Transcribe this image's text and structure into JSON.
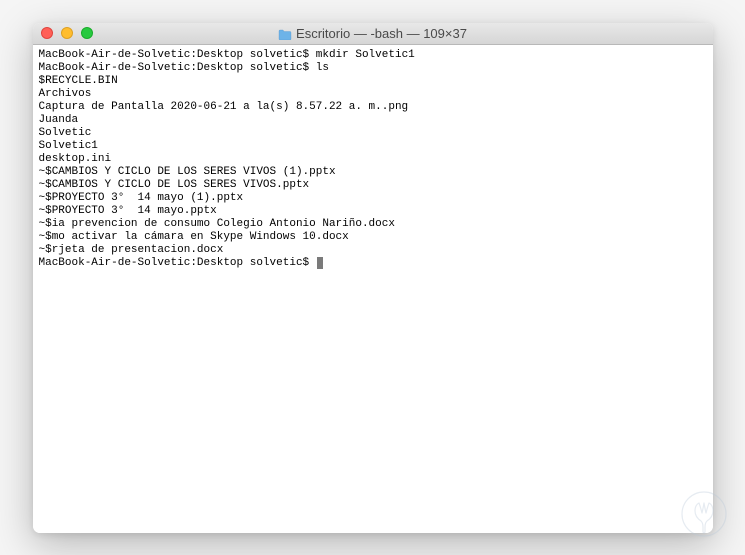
{
  "window": {
    "title": "Escritorio — -bash — 109×37"
  },
  "terminal": {
    "lines": [
      {
        "prompt": "MacBook-Air-de-Solvetic:Desktop solvetic$ ",
        "command": "mkdir Solvetic1"
      },
      {
        "prompt": "MacBook-Air-de-Solvetic:Desktop solvetic$ ",
        "command": "ls"
      },
      {
        "text": "$RECYCLE.BIN"
      },
      {
        "text": "Archivos"
      },
      {
        "text": "Captura de Pantalla 2020-06-21 a la(s) 8.57.22 a. m..png"
      },
      {
        "text": "Juanda"
      },
      {
        "text": "Solvetic"
      },
      {
        "text": "Solvetic1"
      },
      {
        "text": "desktop.ini"
      },
      {
        "text": "~$CAMBIOS Y CICLO DE LOS SERES VIVOS (1).pptx"
      },
      {
        "text": "~$CAMBIOS Y CICLO DE LOS SERES VIVOS.pptx"
      },
      {
        "text": "~$PROYECTO 3°  14 mayo (1).pptx"
      },
      {
        "text": "~$PROYECTO 3°  14 mayo.pptx"
      },
      {
        "text": "~$ia prevencion de consumo Colegio Antonio Nariño.docx"
      },
      {
        "text": "~$mo activar la cámara en Skype Windows 10.docx"
      },
      {
        "text": "~$rjeta de presentacion.docx"
      },
      {
        "prompt": "MacBook-Air-de-Solvetic:Desktop solvetic$ ",
        "command": "",
        "cursor": true
      }
    ]
  },
  "colors": {
    "close": "#ff5f57",
    "minimize": "#ffbd2e",
    "zoom": "#28c940",
    "titlebar_text": "#4a4a4a",
    "terminal_fg": "#000000",
    "terminal_bg": "#ffffff"
  }
}
